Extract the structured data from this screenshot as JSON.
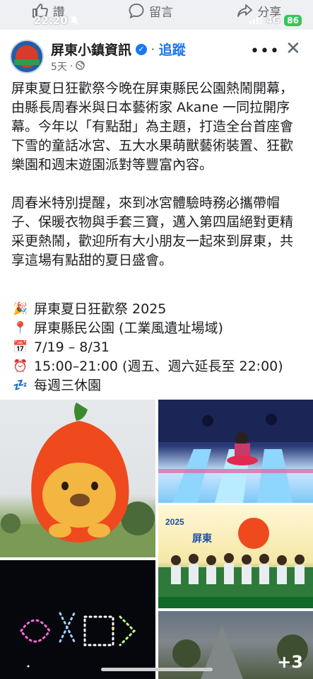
{
  "topbar": {
    "like_label": "讚",
    "comment_label": "留言",
    "share_label": "分享",
    "status_time": "22:20",
    "network": "4G",
    "battery": "86"
  },
  "post": {
    "page_name": "屏東小鎮資訊",
    "follow_label": "追蹤",
    "separator": "·",
    "time_ago": "5天",
    "time_sep": "·",
    "more_label": "•••",
    "close_label": "✕",
    "paragraph1": "屏東夏日狂歡祭今晚在屏東縣民公園熱鬧開幕，由縣長周春米與日本藝術家 Akane 一同拉開序幕。今年以「有點甜」為主題，打造全台首座會下雪的童話冰宮、五大水果萌獸藝術裝置、狂歡樂園和週末遊園派對等豐富內容。",
    "paragraph2": "周春米特別提醒，來到冰宮體驗時務必攜帶帽子、保暖衣物與手套三寶，邁入第四屆絕對更精采更熱鬧，歡迎所有大小朋友一起來到屏東，共享這場有點甜的夏日盛會。",
    "details": [
      {
        "icon": "🎉",
        "icon_name": "party-popper-icon",
        "text": "屏東夏日狂歡祭 2025"
      },
      {
        "icon": "📍",
        "icon_name": "location-pin-icon",
        "text": "屏東縣民公園 (工業風遺址場域)"
      },
      {
        "icon": "📅",
        "icon_name": "calendar-icon",
        "text": "7/19 – 8/31"
      },
      {
        "icon": "⏰",
        "icon_name": "alarm-clock-icon",
        "text": "15:00–21:00 (週五、週六延長至 22:00)"
      },
      {
        "icon": "💤",
        "icon_name": "sleep-icon",
        "text": "每週三休園"
      }
    ],
    "more_photos": "+3"
  },
  "colors": {
    "accent": "#1877f2",
    "text": "#1c1e21",
    "secondary": "#65676b"
  }
}
